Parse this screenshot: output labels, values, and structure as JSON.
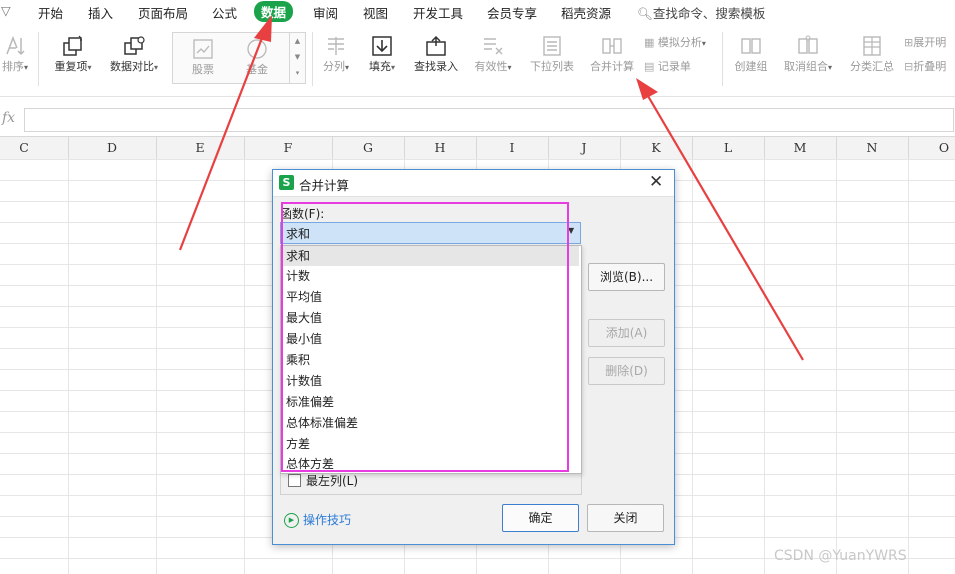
{
  "menu": {
    "items": [
      "开始",
      "插入",
      "页面布局",
      "公式",
      "数据",
      "审阅",
      "视图",
      "开发工具",
      "会员专享",
      "稻壳资源"
    ],
    "active_index": 4,
    "search_text": "查找命令、搜索模板",
    "active_color": "#1aa34a"
  },
  "ribbon": {
    "sort": "排序",
    "duplicates": "重复项",
    "compare": "数据对比",
    "stock": "股票",
    "fund": "基金",
    "split_column": "分列",
    "fill": "填充",
    "lookup_entry": "查找录入",
    "validity": "有效性",
    "dropdown_list": "下拉列表",
    "consolidate": "合并计算",
    "simulate": "模拟分析",
    "record_sheet": "记录单",
    "create_group": "创建组",
    "ungroup": "取消组合",
    "subtotal": "分类汇总",
    "expand_detail": "展开明",
    "collapse_detail": "折叠明"
  },
  "formula_bar": {
    "fx": "fx",
    "value": ""
  },
  "columns": [
    "C",
    "D",
    "E",
    "F",
    "G",
    "H",
    "I",
    "J",
    "K",
    "L",
    "M",
    "N",
    "O"
  ],
  "dialog": {
    "title": "合并计算",
    "logo": "S",
    "close": "✕",
    "function_label": "函数(F):",
    "selected_function": "求和",
    "function_options": [
      "求和",
      "计数",
      "平均值",
      "最大值",
      "最小值",
      "乘积",
      "计数值",
      "标准偏差",
      "总体标准偏差",
      "方差",
      "总体方差"
    ],
    "browse_button": "浏览(B)...",
    "add_button": "添加(A)",
    "delete_button": "删除(D)",
    "left_column_checkbox": "最左列(L)",
    "tips_link": "操作技巧",
    "ok_button": "确定",
    "close_button": "关闭"
  },
  "annotation_colors": {
    "arrow": "#e84040",
    "highlight": "#e63ce0"
  },
  "watermark": "CSDN @YuanYWRS"
}
